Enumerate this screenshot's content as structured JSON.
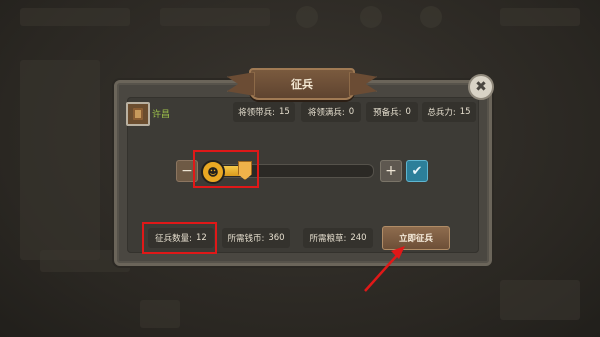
{
  "dialog": {
    "title": "征兵",
    "close_icon": "close-icon",
    "general": {
      "name": "许昌",
      "avatar_icon": "avatar"
    },
    "stats": [
      {
        "label": "将领带兵:",
        "value": "15"
      },
      {
        "label": "将领满兵:",
        "value": "0"
      },
      {
        "label": "预备兵:",
        "value": "0"
      },
      {
        "label": "总兵力:",
        "value": "15"
      }
    ],
    "slider": {
      "minus_label": "−",
      "plus_label": "+",
      "confirm_label": "✔",
      "fill_fraction": 0.24
    },
    "bottom": {
      "recruit_count_label": "征兵数量:",
      "recruit_count": "12",
      "coin_label": "所需钱币:",
      "coin": "360",
      "grain_label": "所需粮草:",
      "grain": "240",
      "recruit_button": "立即征兵"
    }
  },
  "colors": {
    "highlight": "#e01818",
    "accent_gold": "#f5c84a",
    "confirm": "#2c7f9a",
    "name": "#9ec24a"
  }
}
